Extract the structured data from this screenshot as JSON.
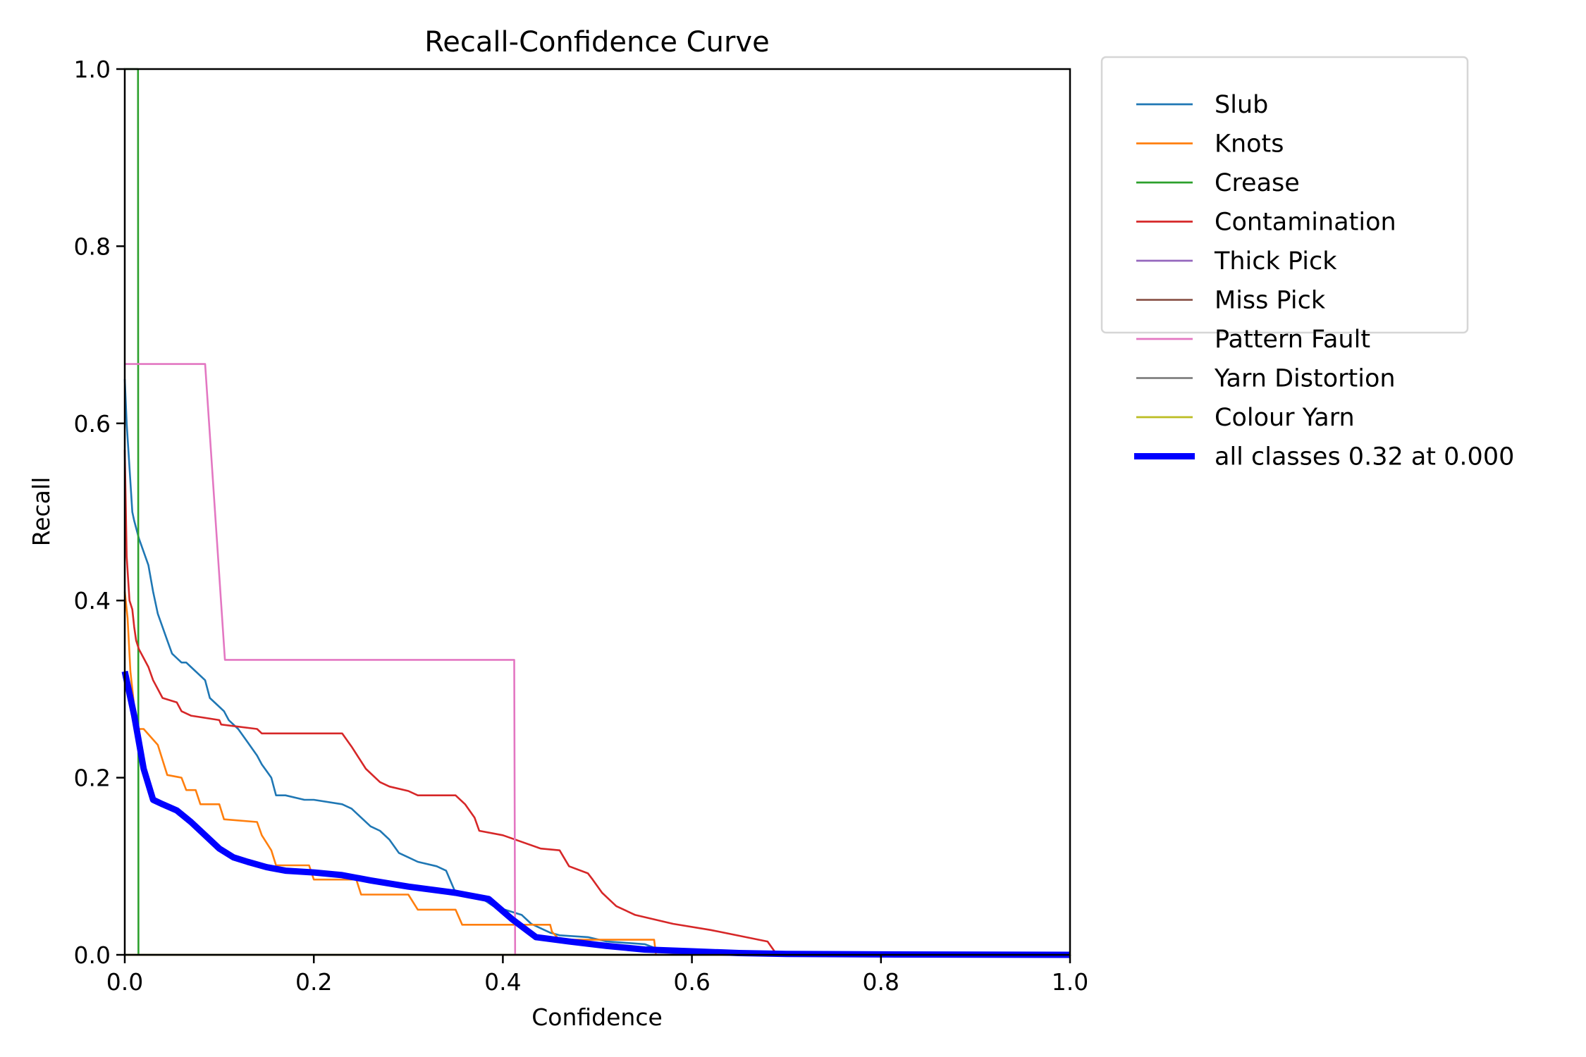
{
  "chart_data": {
    "type": "line",
    "title": "Recall-Confidence Curve",
    "xlabel": "Confidence",
    "ylabel": "Recall",
    "xlim": [
      0,
      1
    ],
    "ylim": [
      0,
      1
    ],
    "xticks": [
      "0.0",
      "0.2",
      "0.4",
      "0.6",
      "0.8",
      "1.0"
    ],
    "yticks": [
      "0.0",
      "0.2",
      "0.4",
      "0.6",
      "0.8",
      "1.0"
    ],
    "grid": false,
    "legend_position": "outside-top-right",
    "series": [
      {
        "name": "Slub",
        "color": "#1f77b4",
        "x": [
          0.0,
          0.002,
          0.005,
          0.008,
          0.01,
          0.015,
          0.02,
          0.025,
          0.03,
          0.035,
          0.04,
          0.045,
          0.05,
          0.06,
          0.065,
          0.07,
          0.085,
          0.09,
          0.1,
          0.105,
          0.11,
          0.12,
          0.13,
          0.14,
          0.145,
          0.155,
          0.16,
          0.17,
          0.19,
          0.2,
          0.23,
          0.24,
          0.25,
          0.26,
          0.27,
          0.28,
          0.29,
          0.3,
          0.31,
          0.33,
          0.34,
          0.35,
          0.37,
          0.38,
          0.39,
          0.42,
          0.43,
          0.44,
          0.45,
          0.46,
          0.49,
          0.51,
          0.55,
          0.56,
          0.6,
          0.7,
          1.0
        ],
        "y": [
          0.65,
          0.6,
          0.55,
          0.5,
          0.49,
          0.47,
          0.455,
          0.44,
          0.41,
          0.385,
          0.37,
          0.355,
          0.34,
          0.33,
          0.33,
          0.325,
          0.31,
          0.29,
          0.28,
          0.275,
          0.265,
          0.255,
          0.24,
          0.225,
          0.215,
          0.2,
          0.18,
          0.18,
          0.175,
          0.175,
          0.17,
          0.165,
          0.155,
          0.145,
          0.14,
          0.13,
          0.115,
          0.11,
          0.105,
          0.1,
          0.095,
          0.07,
          0.068,
          0.062,
          0.055,
          0.045,
          0.035,
          0.03,
          0.025,
          0.022,
          0.02,
          0.015,
          0.012,
          0.008,
          0.003,
          0.0,
          0.0
        ]
      },
      {
        "name": "Knots",
        "color": "#ff7f0e",
        "x": [
          0.0,
          0.003,
          0.006,
          0.01,
          0.012,
          0.02,
          0.035,
          0.04,
          0.045,
          0.06,
          0.065,
          0.075,
          0.08,
          0.1,
          0.105,
          0.14,
          0.145,
          0.155,
          0.16,
          0.195,
          0.2,
          0.245,
          0.25,
          0.3,
          0.31,
          0.35,
          0.357,
          0.4,
          0.45,
          0.452,
          0.46,
          0.5,
          0.56,
          0.562,
          1.0
        ],
        "y": [
          0.41,
          0.38,
          0.32,
          0.28,
          0.255,
          0.255,
          0.237,
          0.22,
          0.203,
          0.2,
          0.186,
          0.186,
          0.17,
          0.17,
          0.153,
          0.15,
          0.135,
          0.118,
          0.101,
          0.101,
          0.085,
          0.085,
          0.068,
          0.068,
          0.051,
          0.051,
          0.034,
          0.034,
          0.034,
          0.026,
          0.017,
          0.017,
          0.017,
          0.0,
          0.0
        ]
      },
      {
        "name": "Crease",
        "color": "#2ca02c",
        "x": [
          0.0,
          0.014,
          0.0145,
          1.0
        ],
        "y": [
          1.0,
          1.0,
          0.0,
          0.0
        ]
      },
      {
        "name": "Contamination",
        "color": "#d62728",
        "x": [
          0.0,
          0.002,
          0.005,
          0.008,
          0.01,
          0.012,
          0.015,
          0.02,
          0.025,
          0.03,
          0.035,
          0.04,
          0.055,
          0.06,
          0.07,
          0.1,
          0.102,
          0.14,
          0.145,
          0.23,
          0.24,
          0.255,
          0.27,
          0.28,
          0.3,
          0.31,
          0.35,
          0.36,
          0.37,
          0.375,
          0.4,
          0.44,
          0.46,
          0.47,
          0.49,
          0.495,
          0.505,
          0.52,
          0.54,
          0.58,
          0.62,
          0.68,
          0.69,
          1.0
        ],
        "y": [
          0.57,
          0.45,
          0.4,
          0.39,
          0.37,
          0.355,
          0.345,
          0.335,
          0.325,
          0.31,
          0.3,
          0.29,
          0.285,
          0.275,
          0.27,
          0.265,
          0.26,
          0.255,
          0.25,
          0.25,
          0.235,
          0.21,
          0.195,
          0.19,
          0.185,
          0.18,
          0.18,
          0.17,
          0.155,
          0.14,
          0.135,
          0.12,
          0.118,
          0.1,
          0.092,
          0.085,
          0.07,
          0.055,
          0.045,
          0.035,
          0.028,
          0.015,
          0.0,
          0.0
        ]
      },
      {
        "name": "Thick Pick",
        "color": "#9467bd",
        "x": [
          0.0,
          1.0
        ],
        "y": [
          0.0,
          0.0
        ]
      },
      {
        "name": "Miss Pick",
        "color": "#8c564b",
        "x": [
          0.0,
          1.0
        ],
        "y": [
          0.0,
          0.0
        ]
      },
      {
        "name": "Pattern Fault",
        "color": "#e377c2",
        "x": [
          0.0,
          0.085,
          0.106,
          0.412,
          0.413,
          1.0
        ],
        "y": [
          0.667,
          0.667,
          0.333,
          0.333,
          0.0,
          0.0
        ]
      },
      {
        "name": "Yarn Distortion",
        "color": "#7f7f7f",
        "x": [
          0.0,
          1.0
        ],
        "y": [
          0.0,
          0.0
        ]
      },
      {
        "name": "Colour Yarn",
        "color": "#bcbd22",
        "x": [
          0.0,
          1.0
        ],
        "y": [
          0.0,
          0.0
        ]
      },
      {
        "name": "all classes 0.32 at 0.000",
        "color": "#0000ff",
        "bold": true,
        "x": [
          0.0,
          0.01,
          0.02,
          0.03,
          0.04,
          0.055,
          0.07,
          0.085,
          0.1,
          0.115,
          0.13,
          0.15,
          0.17,
          0.2,
          0.23,
          0.26,
          0.3,
          0.35,
          0.385,
          0.41,
          0.435,
          0.47,
          0.51,
          0.55,
          0.6,
          0.65,
          0.7,
          0.8,
          1.0
        ],
        "y": [
          0.32,
          0.27,
          0.21,
          0.175,
          0.17,
          0.163,
          0.15,
          0.135,
          0.12,
          0.11,
          0.105,
          0.099,
          0.095,
          0.093,
          0.09,
          0.084,
          0.077,
          0.07,
          0.063,
          0.04,
          0.02,
          0.015,
          0.01,
          0.006,
          0.004,
          0.002,
          0.001,
          0.0005,
          0.0
        ]
      }
    ]
  }
}
